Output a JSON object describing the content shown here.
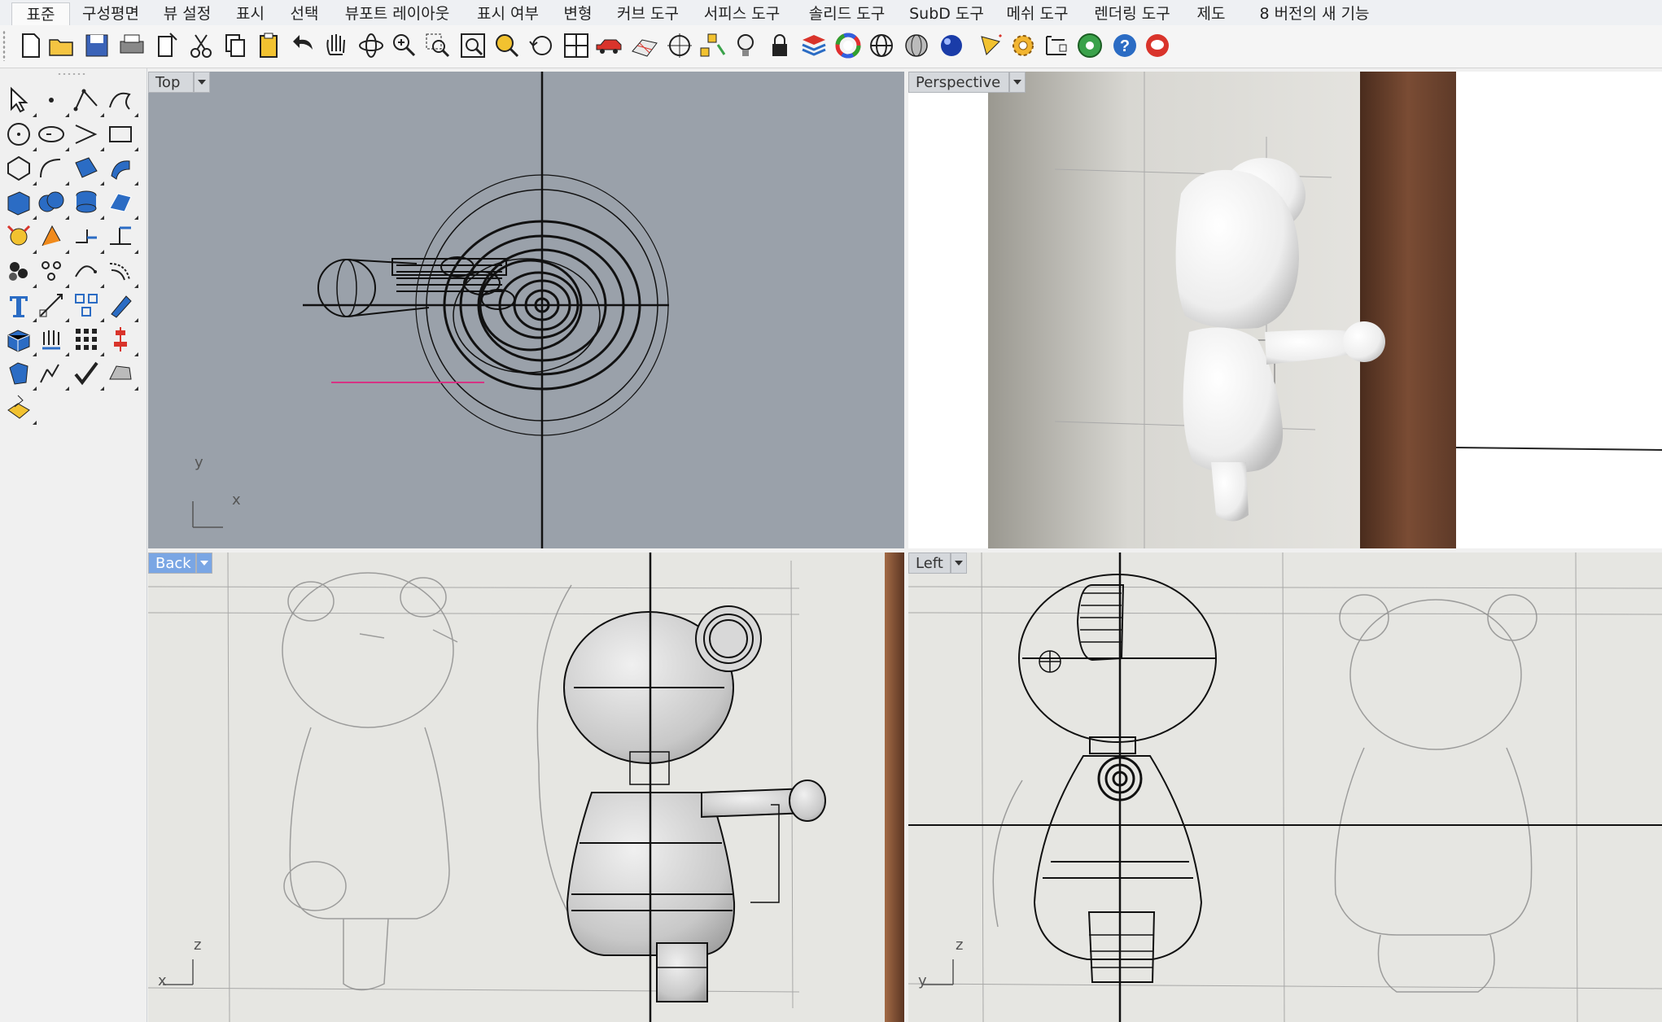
{
  "tabs": [
    "표준",
    "구성평면",
    "뷰 설정",
    "표시",
    "선택",
    "뷰포트 레이아웃",
    "표시 여부",
    "변형",
    "커브 도구",
    "서피스 도구",
    "솔리드 도구",
    "SubD 도구",
    "메쉬 도구",
    "렌더링 도구",
    "제도",
    "8 버전의 새 기능"
  ],
  "active_tab": "표준",
  "toolbar_icons": [
    "new-file-icon",
    "open-folder-icon",
    "save-icon",
    "print-icon",
    "import-icon",
    "cut-icon",
    "copy-icon",
    "paste-icon",
    "undo-icon",
    "pan-hand-icon",
    "rotate-view-icon",
    "zoom-icon",
    "zoom-window-icon",
    "zoom-extents-icon",
    "zoom-selected-icon",
    "undo-view-icon",
    "four-viewports-icon",
    "car-object-icon",
    "cplane-grid-icon",
    "osnap-icon",
    "select-objects-icon",
    "light-icon",
    "lock-icon",
    "layer-icon",
    "color-wheel-icon",
    "wireframe-sphere-icon",
    "shaded-sphere-icon",
    "rendered-sphere-icon",
    "material-pen-icon",
    "settings-gear-icon",
    "dimension-icon",
    "globe-icon",
    "help-icon",
    "support-chat-icon"
  ],
  "sidebar_icons": [
    "select-arrow-icon",
    "point-icon",
    "polyline-icon",
    "curve-icon",
    "circle-icon",
    "ellipse-icon",
    "polygon-arc-icon",
    "rectangle-icon",
    "polygon-icon",
    "arc-icon",
    "surface-patch-icon",
    "surface-from-curves-icon",
    "box-solid-icon",
    "boolean-union-icon",
    "cylinder-icon",
    "mesh-surface-icon",
    "explode-join-icon",
    "fillet-icon",
    "extend-icon",
    "trim-icon",
    "group-icon",
    "points-cloud-icon",
    "curve-tool-icon",
    "offset-curve-icon",
    "text-icon",
    "scale-icon",
    "array-icon",
    "edit-pen-icon",
    "solid-box-icon",
    "extrude-icon",
    "grid-array-icon",
    "align-icon",
    "solid-edit-icon",
    "split-icon",
    "check-icon",
    "shell-icon",
    "shaded-box-icon"
  ],
  "viewports": {
    "top": {
      "label": "Top",
      "axis_x": "x",
      "axis_y": "y"
    },
    "perspective": {
      "label": "Perspective"
    },
    "back": {
      "label": "Back",
      "axis_x": "x",
      "axis_y": "z"
    },
    "left": {
      "label": "Left",
      "axis_x": "y",
      "axis_y": "z"
    }
  },
  "active_viewport": "Back",
  "colors": {
    "accent": "#7aa6e4",
    "top_bg": "#9aa1aa",
    "paper": "#e6e6e2",
    "wood": "#6b4330",
    "selection_line": "#d63384"
  }
}
